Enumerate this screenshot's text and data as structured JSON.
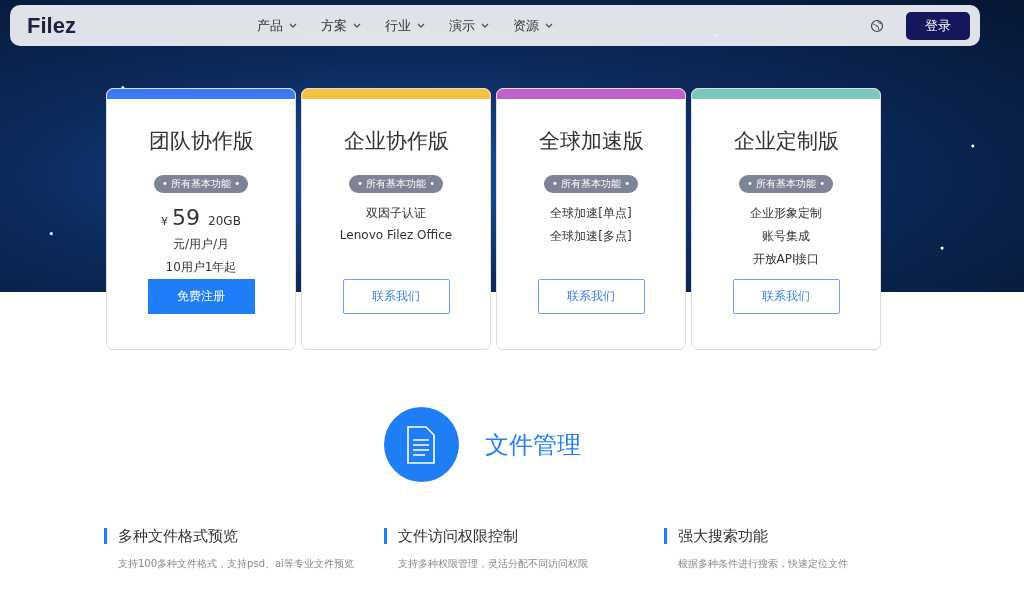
{
  "nav": {
    "logo": "Filez",
    "menu": [
      {
        "label": "产品"
      },
      {
        "label": "方案"
      },
      {
        "label": "行业"
      },
      {
        "label": "演示"
      },
      {
        "label": "资源"
      }
    ],
    "login_button": "登录"
  },
  "plans": [
    {
      "title": "团队协作版",
      "color": "#3b7cf4",
      "badge": "• 所有基本功能 •",
      "kind": "price",
      "currency": "¥",
      "price": "59",
      "storage": "20GB",
      "lines": [
        "元/用户/月",
        "10用户1年起"
      ],
      "button": {
        "label": "免费注册",
        "kind": "primary"
      }
    },
    {
      "title": "企业协作版",
      "color": "#f5c242",
      "badge": "• 所有基本功能 •",
      "kind": "features",
      "lines": [
        "双因子认证",
        "Lenovo Filez Office"
      ],
      "button": {
        "label": "联系我们",
        "kind": "outline"
      }
    },
    {
      "title": "全球加速版",
      "color": "#c161cc",
      "badge": "• 所有基本功能 •",
      "kind": "features",
      "lines": [
        "全球加速[单点]",
        "全球加速[多点]"
      ],
      "button": {
        "label": "联系我们",
        "kind": "outline"
      }
    },
    {
      "title": "企业定制版",
      "color": "#78c9bb",
      "badge": "• 所有基本功能 •",
      "kind": "features",
      "lines": [
        "企业形象定制",
        "账号集成",
        "开放API接口"
      ],
      "button": {
        "label": "联系我们",
        "kind": "outline"
      }
    }
  ],
  "section": {
    "title": "文件管理",
    "features": [
      {
        "title": "多种文件格式预览",
        "description": "支持100多种文件格式，支持psd、ai等专业文件预览"
      },
      {
        "title": "文件访问权限控制",
        "description": "支持多种权限管理，灵活分配不同访问权限"
      },
      {
        "title": "强大搜索功能",
        "description": "根据多种条件进行搜索，快速定位文件"
      }
    ]
  }
}
